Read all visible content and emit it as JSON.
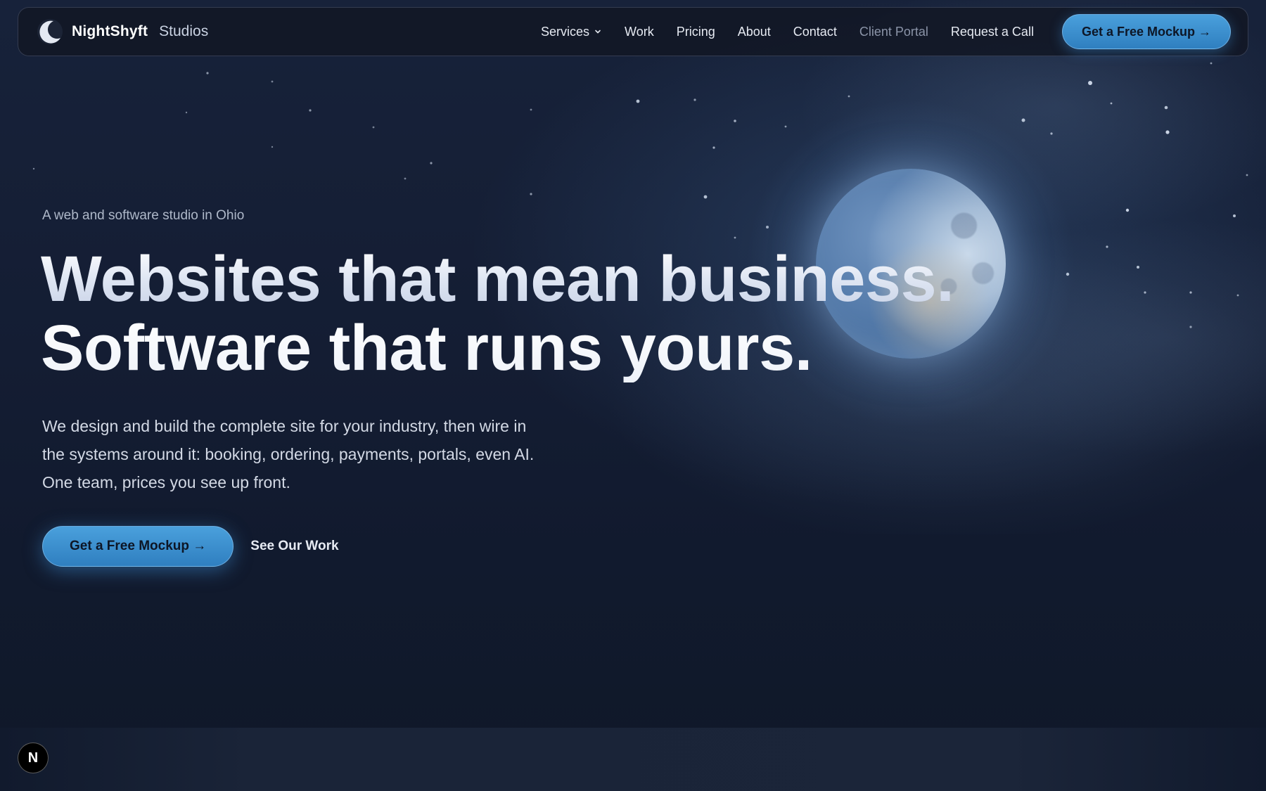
{
  "nav": {
    "brand_name": "NightShyft",
    "brand_suffix": "Studios",
    "links": [
      {
        "label": "Services"
      },
      {
        "label": "Work"
      },
      {
        "label": "Pricing"
      },
      {
        "label": "About"
      },
      {
        "label": "Contact"
      },
      {
        "label": "Client Portal"
      },
      {
        "label": "Request a Call"
      }
    ],
    "cta_label": "Get a Free Mockup →"
  },
  "hero": {
    "eyebrow": "A web and software studio in Ohio",
    "headline_line1": "Websites that mean business.",
    "headline_line2": "Software that runs yours.",
    "lede": "We design and build the complete site for your industry, then wire in the systems around it: booking, ordering, payments, portals, even AI. One team, prices you see up front.",
    "primary_cta": "Get a Free Mockup →",
    "secondary_cta": "See Our Work"
  },
  "badge": {
    "letter": "N"
  },
  "colors": {
    "background": "#10172a",
    "accent": "#3a8fd0",
    "muted_link": "#8b94a8"
  },
  "icons": {
    "logo": "crescent-moon-icon",
    "services_dropdown": "chevron-down-icon"
  }
}
